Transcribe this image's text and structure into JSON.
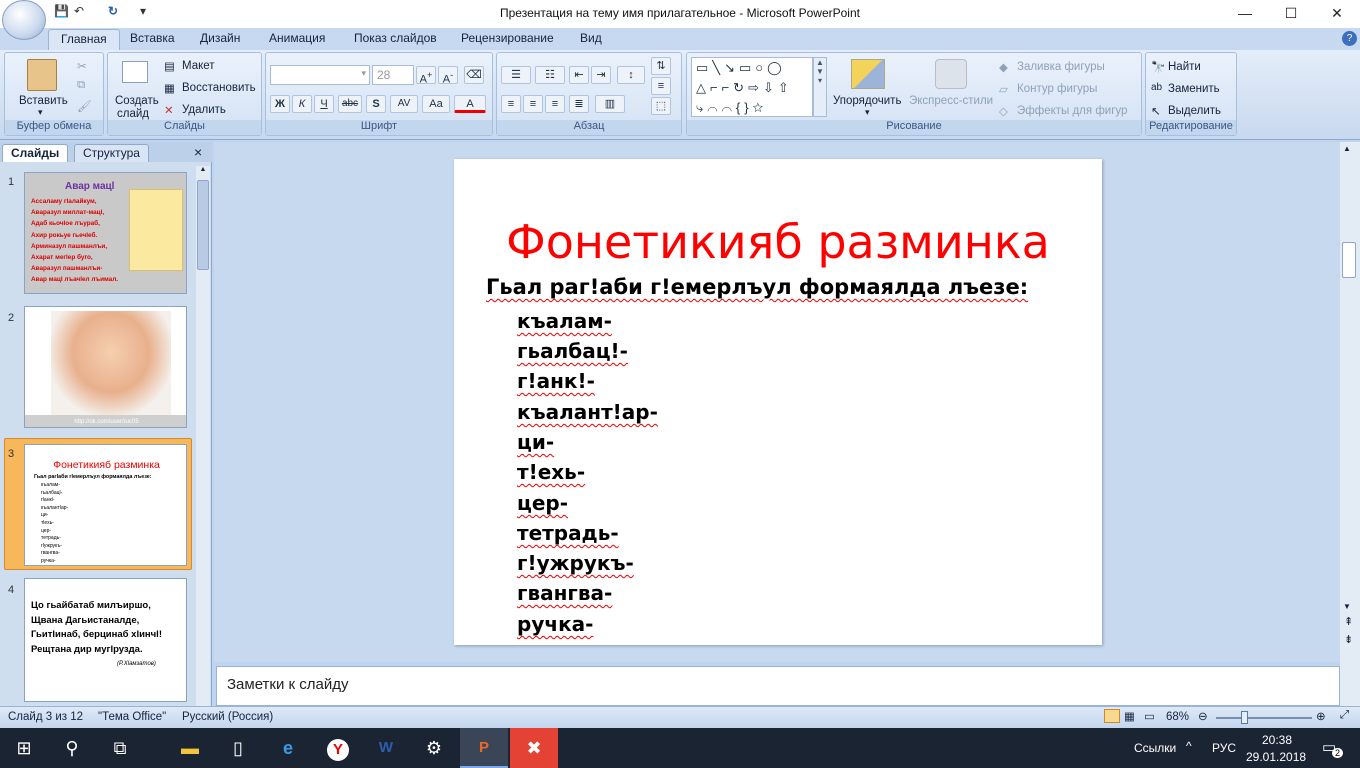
{
  "window": {
    "title": "Презентация на тему имя прилагательное - Microsoft PowerPoint",
    "controls": {
      "minimize": "—",
      "maximize": "☐",
      "close": "✕"
    }
  },
  "ribbon_tabs": [
    "Главная",
    "Вставка",
    "Дизайн",
    "Анимация",
    "Показ слайдов",
    "Рецензирование",
    "Вид"
  ],
  "ribbon": {
    "clipboard": {
      "paste": "Вставить",
      "label": "Буфер обмена"
    },
    "slides": {
      "create": "Создать",
      "create2": "слайд",
      "layout": "Макет",
      "reset": "Восстановить",
      "delete": "Удалить",
      "label": "Слайды"
    },
    "font": {
      "size": "28",
      "bold": "Ж",
      "italic": "К",
      "underline": "Ч",
      "strike": "abc",
      "shadow": "S",
      "spacing": "AV",
      "case": "Aa",
      "color": "A",
      "label": "Шрифт"
    },
    "paragraph": {
      "label": "Абзац"
    },
    "drawing": {
      "arrange": "Упорядочить",
      "styles": "Экспресс-стили",
      "fill": "Заливка фигуры",
      "outline": "Контур фигуры",
      "effects": "Эффекты для фигур",
      "label": "Рисование"
    },
    "editing": {
      "find": "Найти",
      "replace": "Заменить",
      "select": "Выделить",
      "label": "Редактирование"
    }
  },
  "pane_tabs": {
    "slides": "Слайды",
    "outline": "Структура",
    "close": "×"
  },
  "thumbnails": [
    {
      "num": "1",
      "title": "Авар мацl",
      "lines": [
        "Ассаламу гlалайкум,",
        "Аваразул миллат-мацl,",
        "Адаб кьочlое лъураб,",
        "Ахир рокьуе гьечlеб.",
        "Арминазул пашманлъи,",
        "Ахарат мегlер буго,",
        "Аваразул пашманлъи-",
        "Авар мацl лъачlел лъимал."
      ]
    },
    {
      "num": "2",
      "caption": "http://ok.com/user/ruc05"
    },
    {
      "num": "3",
      "title": "Фонетикияб разминка",
      "sub": "Гьал рагlаби гlемерлъул формаялда лъезе:",
      "words": [
        "къалам-",
        "гьалбацl-",
        "гlанкl-",
        "къалантlар-",
        "ци-",
        "тlехь-",
        "цер-",
        "тетрадь-",
        "гlужрукъ-",
        "гвангва-",
        "ручка-"
      ]
    },
    {
      "num": "4",
      "lines": [
        "Цо гьайбатаб милъиршо,",
        "Щвана Дагьистаналде,",
        "Гьитlинаб, берцинаб хlинчl!",
        "Рещтана дир мугlрузда."
      ],
      "author": "(Р.Хlамзатов)"
    }
  ],
  "slide": {
    "title": "Фонетикияб разминка",
    "subtitle": "Гьал раг!аби г!емерлъул формаялда лъезе:",
    "words": [
      "къалам-",
      "гьалбац!-",
      "г!анк!-",
      "къалант!ар-",
      "ци-",
      "т!ехь-",
      "цер-",
      "тетрадь-",
      "г!ужрукъ-",
      "гвангва-",
      "ручка-"
    ]
  },
  "notes_placeholder": "Заметки к слайду",
  "status": {
    "slide_count": "Слайд 3 из 12",
    "theme": "\"Тема Office\"",
    "language": "Русский (Россия)",
    "zoom": "68%"
  },
  "taskbar": {
    "links": "Ссылки",
    "lang": "РУС",
    "time": "20:38",
    "date": "29.01.2018",
    "notif": "2"
  }
}
